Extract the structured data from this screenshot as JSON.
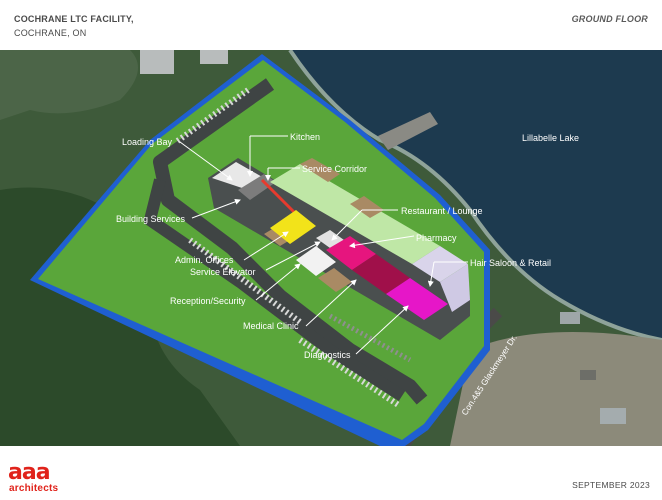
{
  "header": {
    "title_line1": "COCHRANE LTC FACILITY,",
    "title_line2": "COCHRANE, ON",
    "floor": "GROUND FLOOR"
  },
  "map": {
    "lake_name": "Lillabelle Lake",
    "road_name": "Con.4&5 Glackmeyer Dr.",
    "labels": {
      "loading_bay": "Loading Bay",
      "kitchen": "Kitchen",
      "service_corridor": "Service Corridor",
      "building_services": "Building Services",
      "restaurant_lounge": "Restaurant / Lounge",
      "pharmacy": "Pharmacy",
      "admin_offices": "Admin. Offices",
      "service_elevator": "Service Elevator",
      "hair_salon_retail": "Hair Saloon & Retail",
      "reception_security": "Reception/Security",
      "medical_clinic": "Medical Clinic",
      "diagnostics": "Diagnostics"
    },
    "colors": {
      "site_green": "#5aa63a",
      "boundary_blue": "#1f5fd1",
      "kitchen_yellow": "#f2e31a",
      "pharmacy_magenta": "#e6157e",
      "diagnostics_magenta": "#e616c8",
      "restaurant_green": "#bfe7a6",
      "retail_lavender": "#d9d4ea"
    }
  },
  "logo": {
    "mark": "aaa",
    "word": "architects"
  },
  "footer": {
    "date": "SEPTEMBER 2023"
  }
}
